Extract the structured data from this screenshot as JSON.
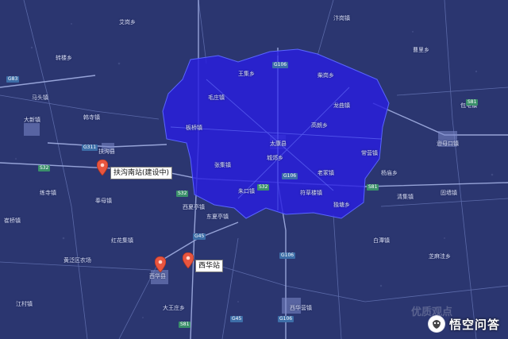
{
  "map": {
    "background_color": "#2b3670",
    "highlight_color": "#2a1ee0"
  },
  "highlighted_region": {
    "name": "",
    "fill_color": "#2a1ee0"
  },
  "markers": [
    {
      "label": "扶沟南站(建设中)",
      "icon": "map-pin-icon",
      "color": "#e8553f"
    },
    {
      "label": "西华站",
      "icon": "map-pin-icon",
      "color": "#e8553f"
    },
    {
      "label": "",
      "icon": "map-pin-icon",
      "color": "#e8553f"
    }
  ],
  "road_shields": [
    {
      "text": "G311",
      "kind": "national"
    },
    {
      "text": "G106",
      "kind": "national"
    },
    {
      "text": "G106",
      "kind": "national"
    },
    {
      "text": "G106",
      "kind": "national"
    },
    {
      "text": "G106",
      "kind": "national"
    },
    {
      "text": "G45",
      "kind": "national"
    },
    {
      "text": "G45",
      "kind": "national"
    },
    {
      "text": "G83",
      "kind": "national"
    },
    {
      "text": "S32",
      "kind": "provincial"
    },
    {
      "text": "S32",
      "kind": "provincial"
    },
    {
      "text": "S32",
      "kind": "provincial"
    },
    {
      "text": "S81",
      "kind": "provincial"
    },
    {
      "text": "S81",
      "kind": "provincial"
    },
    {
      "text": "S81",
      "kind": "provincial"
    }
  ],
  "place_labels": [
    "大新镇",
    "韩寺镇",
    "扶沟县",
    "太康县",
    "西华县",
    "逊母口镇",
    "西华营镇",
    "城郊乡",
    "王集乡",
    "柴岗乡",
    "马头镇",
    "转楼乡",
    "板桥镇",
    "毛庄镇",
    "龙曲镇",
    "常营镇",
    "老冢镇",
    "高朗乡",
    "朱口镇",
    "独塘乡",
    "杨庙乡",
    "张集镇",
    "符草楼镇",
    "清集镇",
    "芝麻洼乡",
    "东夏亭镇",
    "红花集镇",
    "西夏亭镇",
    "奉母镇",
    "大王庄乡",
    "黄泛区农场",
    "练寺镇",
    "崔桥镇",
    "江村镇",
    "白潭镇",
    "固墙镇",
    "包屯镇",
    "曹里乡",
    "汴岗镇",
    "艾岗乡"
  ],
  "watermark": {
    "text": "悟空问答",
    "ghost_text": "优质观点"
  }
}
